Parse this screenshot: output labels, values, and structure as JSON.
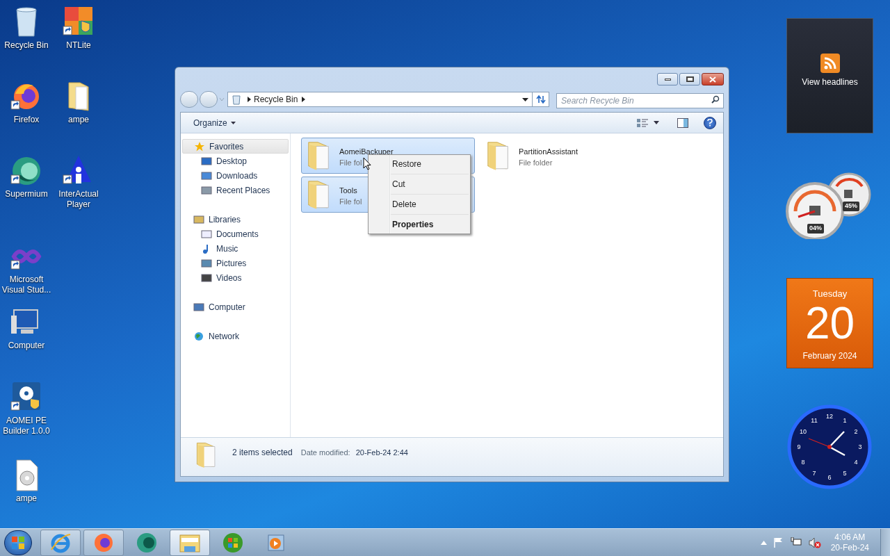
{
  "desktop_icons": [
    {
      "label": "Recycle Bin",
      "kind": "recycle-bin",
      "shortcut": false
    },
    {
      "label": "NTLite",
      "kind": "app",
      "shortcut": true
    },
    {
      "label": "Firefox",
      "kind": "firefox",
      "shortcut": true
    },
    {
      "label": "ampe",
      "kind": "folder",
      "shortcut": false
    },
    {
      "label": "Supermium",
      "kind": "supermium",
      "shortcut": true
    },
    {
      "label": "InterActual Player",
      "kind": "player",
      "shortcut": true
    },
    {
      "label": "Microsoft Visual Stud...",
      "kind": "infinity",
      "shortcut": true
    },
    {
      "label": "Computer",
      "kind": "computer",
      "shortcut": false
    },
    {
      "label": "AOMEI PE Builder 1.0.0",
      "kind": "installer",
      "shortcut": true
    },
    {
      "label": "ampe",
      "kind": "disc-file",
      "shortcut": false
    }
  ],
  "window": {
    "address": {
      "path": "Recycle Bin"
    },
    "search": {
      "placeholder": "Search Recycle Bin"
    },
    "toolbar": {
      "organize": "Organize"
    },
    "navigation": [
      {
        "label": "Favorites",
        "kind": "star",
        "selected": true,
        "children": [
          {
            "label": "Desktop",
            "kind": "desktop"
          },
          {
            "label": "Downloads",
            "kind": "downloads"
          },
          {
            "label": "Recent Places",
            "kind": "recent"
          }
        ]
      },
      {
        "label": "Libraries",
        "kind": "library",
        "selected": false,
        "children": [
          {
            "label": "Documents",
            "kind": "documents"
          },
          {
            "label": "Music",
            "kind": "music"
          },
          {
            "label": "Pictures",
            "kind": "pictures"
          },
          {
            "label": "Videos",
            "kind": "videos"
          }
        ]
      },
      {
        "label": "Computer",
        "kind": "computer",
        "selected": false
      },
      {
        "label": "Network",
        "kind": "network",
        "selected": false
      }
    ],
    "files": [
      {
        "name": "AomeiBackuper",
        "type": "File fol",
        "selected": true
      },
      {
        "name": "PartitionAssistant",
        "type": "File folder",
        "selected": false
      },
      {
        "name": "Tools",
        "type": "File fol",
        "selected": true
      }
    ],
    "context_menu": [
      {
        "label": "Restore",
        "default": false
      },
      {
        "label": "Cut",
        "default": false
      },
      {
        "label": "Delete",
        "default": false
      },
      {
        "label": "Properties",
        "default": true
      }
    ],
    "details": {
      "summary": "2 items selected",
      "field": "Date modified:",
      "value": "20-Feb-24 2:44"
    }
  },
  "gadgets": {
    "feed": {
      "label": "View headlines"
    },
    "meters": {
      "cpu": "04%",
      "memory": "45%"
    },
    "calendar": {
      "weekday": "Tuesday",
      "day": "20",
      "month": "February 2024"
    },
    "clock": {
      "numerals": [
        "12",
        "1",
        "2",
        "3",
        "4",
        "5",
        "6",
        "7",
        "8",
        "9",
        "10",
        "11"
      ]
    }
  },
  "taskbar": {
    "items": [
      {
        "kind": "ie",
        "running": true,
        "selected": false
      },
      {
        "kind": "firefox",
        "running": true,
        "selected": false
      },
      {
        "kind": "supermium",
        "running": false,
        "selected": false
      },
      {
        "kind": "explorer",
        "running": true,
        "selected": true
      },
      {
        "kind": "media-center",
        "running": false,
        "selected": false
      },
      {
        "kind": "media-player",
        "running": false,
        "selected": false
      }
    ],
    "clock": {
      "time": "4:06 AM",
      "date": "20-Feb-24"
    }
  }
}
